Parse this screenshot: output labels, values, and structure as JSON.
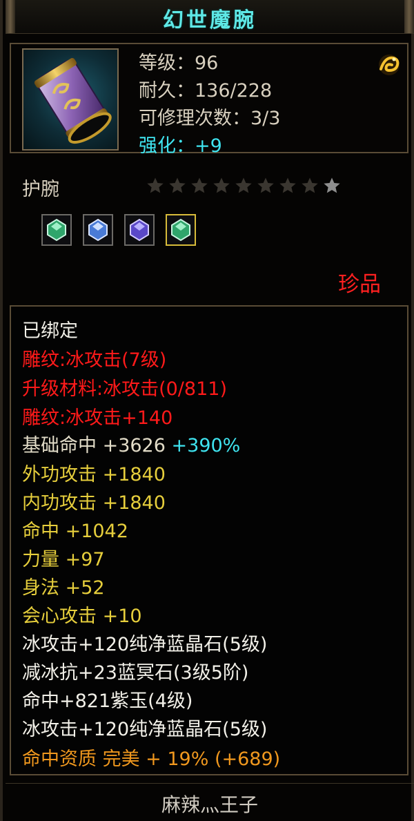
{
  "title": "幻世魔腕",
  "item": {
    "icon": "purple-gold-bracer-icon",
    "stats": [
      {
        "label": "等级",
        "sep": "：",
        "value": "96"
      },
      {
        "label": "耐久",
        "sep": "：",
        "value": "136/228"
      },
      {
        "label": "可修理次数",
        "sep": "：",
        "value": "3/3"
      },
      {
        "label": "强化",
        "sep": "：",
        "value": "+9"
      }
    ],
    "type": "护腕",
    "stars_total": 9,
    "stars_lit": 1,
    "gems": [
      "green-gem-icon",
      "blue-gem-icon",
      "purple-gem-icon",
      "green-gem-icon"
    ],
    "rarity": "珍品"
  },
  "attributes": {
    "bound": "已绑定",
    "engrave1": "雕纹:冰攻击(7级)",
    "upgrade": "升级材料:冰攻击(0/811)",
    "engrave2": "雕纹:冰攻击+140",
    "base_hit": "基础命中  +3626",
    "base_hit_bonus": "+390%",
    "ext_atk": "外功攻击  +1840",
    "int_atk": "内功攻击  +1840",
    "hit": "命中  +1042",
    "str": "力量  +97",
    "agi": "身法  +52",
    "crit": "会心攻击  +10",
    "gem1": "冰攻击+120纯净蓝晶石(5级)",
    "gem2": "减冰抗+23蓝冥石(3级5阶)",
    "gem3": "命中+821紫玉(4级)",
    "gem4": "冰攻击+120纯净蓝晶石(5级)",
    "quality": "命中资质  完美  +  19%  (+689)"
  },
  "owner": "麻辣灬王子",
  "colors": {
    "title": "#5ee8e6",
    "cyan": "#3fe4f0",
    "red": "#ff1a1a",
    "yellow": "#e6ce3c",
    "orange": "#f0981e",
    "rarity": "#ff2020"
  }
}
